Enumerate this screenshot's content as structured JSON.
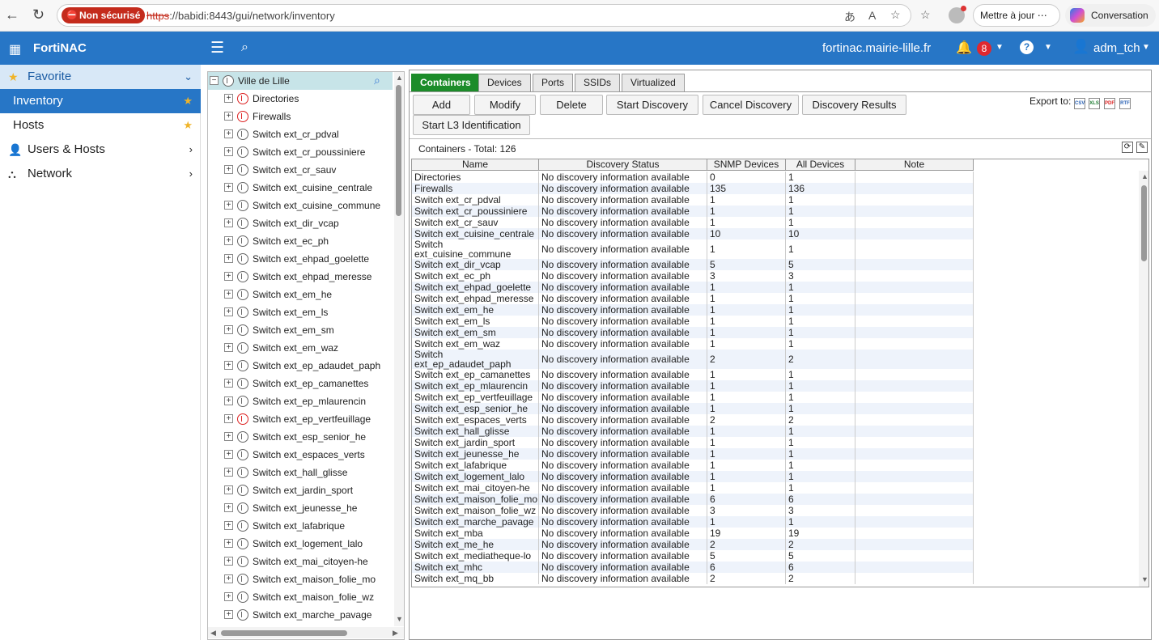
{
  "browser": {
    "insecure_label": "Non sécurisé",
    "url_proto": "https",
    "url_rest": "://babidi:8443/gui/network/inventory",
    "update_label": "Mettre à jour",
    "conversation_label": "Conversation"
  },
  "app": {
    "title": "FortiNAC",
    "hostname": "fortinac.mairie-lille.fr",
    "notification_count": "8",
    "username": "adm_tch"
  },
  "sidebar": {
    "favorite": "Favorite",
    "inventory": "Inventory",
    "hosts": "Hosts",
    "users_hosts": "Users & Hosts",
    "network": "Network"
  },
  "tree": {
    "root": "Ville de Lille",
    "items": [
      {
        "label": "Directories",
        "status": "red"
      },
      {
        "label": "Firewalls",
        "status": "red"
      },
      {
        "label": "Switch ext_cr_pdval",
        "status": "ok"
      },
      {
        "label": "Switch ext_cr_poussiniere",
        "status": "ok"
      },
      {
        "label": "Switch ext_cr_sauv",
        "status": "ok"
      },
      {
        "label": "Switch ext_cuisine_centrale",
        "status": "ok"
      },
      {
        "label": "Switch ext_cuisine_commune",
        "status": "ok"
      },
      {
        "label": "Switch ext_dir_vcap",
        "status": "ok"
      },
      {
        "label": "Switch ext_ec_ph",
        "status": "ok"
      },
      {
        "label": "Switch ext_ehpad_goelette",
        "status": "ok"
      },
      {
        "label": "Switch ext_ehpad_meresse",
        "status": "ok"
      },
      {
        "label": "Switch ext_em_he",
        "status": "ok"
      },
      {
        "label": "Switch ext_em_ls",
        "status": "ok"
      },
      {
        "label": "Switch ext_em_sm",
        "status": "ok"
      },
      {
        "label": "Switch ext_em_waz",
        "status": "ok"
      },
      {
        "label": "Switch ext_ep_adaudet_paph",
        "status": "ok"
      },
      {
        "label": "Switch ext_ep_camanettes",
        "status": "ok"
      },
      {
        "label": "Switch ext_ep_mlaurencin",
        "status": "ok"
      },
      {
        "label": "Switch ext_ep_vertfeuillage",
        "status": "red"
      },
      {
        "label": "Switch ext_esp_senior_he",
        "status": "ok"
      },
      {
        "label": "Switch ext_espaces_verts",
        "status": "ok"
      },
      {
        "label": "Switch ext_hall_glisse",
        "status": "ok"
      },
      {
        "label": "Switch ext_jardin_sport",
        "status": "ok"
      },
      {
        "label": "Switch ext_jeunesse_he",
        "status": "ok"
      },
      {
        "label": "Switch ext_lafabrique",
        "status": "ok"
      },
      {
        "label": "Switch ext_logement_lalo",
        "status": "ok"
      },
      {
        "label": "Switch ext_mai_citoyen-he",
        "status": "ok"
      },
      {
        "label": "Switch ext_maison_folie_mo",
        "status": "ok"
      },
      {
        "label": "Switch ext_maison_folie_wz",
        "status": "ok"
      },
      {
        "label": "Switch ext_marche_pavage",
        "status": "ok"
      }
    ]
  },
  "tabs": [
    "Containers",
    "Devices",
    "Ports",
    "SSIDs",
    "Virtualized Devices"
  ],
  "buttons": {
    "add": "Add",
    "modify": "Modify",
    "delete": "Delete",
    "start_discovery": "Start Discovery",
    "cancel_discovery": "Cancel Discovery",
    "discovery_results": "Discovery Results",
    "start_l3": "Start L3 Identification"
  },
  "export_label": "Export to:",
  "export_formats": [
    "CSV",
    "XLS",
    "PDF",
    "RTF"
  ],
  "total_label": "Containers - Total: 126",
  "table": {
    "columns": [
      "Name",
      "Discovery Status",
      "SNMP Devices",
      "All Devices",
      "Note"
    ],
    "rows": [
      [
        "Directories",
        "No discovery information available",
        "0",
        "1",
        ""
      ],
      [
        "Firewalls",
        "No discovery information available",
        "135",
        "136",
        ""
      ],
      [
        "Switch ext_cr_pdval",
        "No discovery information available",
        "1",
        "1",
        ""
      ],
      [
        "Switch ext_cr_poussiniere",
        "No discovery information available",
        "1",
        "1",
        ""
      ],
      [
        "Switch ext_cr_sauv",
        "No discovery information available",
        "1",
        "1",
        ""
      ],
      [
        "Switch ext_cuisine_centrale",
        "No discovery information available",
        "10",
        "10",
        ""
      ],
      [
        "Switch ext_cuisine_commune",
        "No discovery information available",
        "1",
        "1",
        ""
      ],
      [
        "Switch ext_dir_vcap",
        "No discovery information available",
        "5",
        "5",
        ""
      ],
      [
        "Switch ext_ec_ph",
        "No discovery information available",
        "3",
        "3",
        ""
      ],
      [
        "Switch ext_ehpad_goelette",
        "No discovery information available",
        "1",
        "1",
        ""
      ],
      [
        "Switch ext_ehpad_meresse",
        "No discovery information available",
        "1",
        "1",
        ""
      ],
      [
        "Switch ext_em_he",
        "No discovery information available",
        "1",
        "1",
        ""
      ],
      [
        "Switch ext_em_ls",
        "No discovery information available",
        "1",
        "1",
        ""
      ],
      [
        "Switch ext_em_sm",
        "No discovery information available",
        "1",
        "1",
        ""
      ],
      [
        "Switch ext_em_waz",
        "No discovery information available",
        "1",
        "1",
        ""
      ],
      [
        "Switch ext_ep_adaudet_paph",
        "No discovery information available",
        "2",
        "2",
        ""
      ],
      [
        "Switch ext_ep_camanettes",
        "No discovery information available",
        "1",
        "1",
        ""
      ],
      [
        "Switch ext_ep_mlaurencin",
        "No discovery information available",
        "1",
        "1",
        ""
      ],
      [
        "Switch ext_ep_vertfeuillage",
        "No discovery information available",
        "1",
        "1",
        ""
      ],
      [
        "Switch ext_esp_senior_he",
        "No discovery information available",
        "1",
        "1",
        ""
      ],
      [
        "Switch ext_espaces_verts",
        "No discovery information available",
        "2",
        "2",
        ""
      ],
      [
        "Switch ext_hall_glisse",
        "No discovery information available",
        "1",
        "1",
        ""
      ],
      [
        "Switch ext_jardin_sport",
        "No discovery information available",
        "1",
        "1",
        ""
      ],
      [
        "Switch ext_jeunesse_he",
        "No discovery information available",
        "1",
        "1",
        ""
      ],
      [
        "Switch ext_lafabrique",
        "No discovery information available",
        "1",
        "1",
        ""
      ],
      [
        "Switch ext_logement_lalo",
        "No discovery information available",
        "1",
        "1",
        ""
      ],
      [
        "Switch ext_mai_citoyen-he",
        "No discovery information available",
        "1",
        "1",
        ""
      ],
      [
        "Switch ext_maison_folie_mo",
        "No discovery information available",
        "6",
        "6",
        ""
      ],
      [
        "Switch ext_maison_folie_wz",
        "No discovery information available",
        "3",
        "3",
        ""
      ],
      [
        "Switch ext_marche_pavage",
        "No discovery information available",
        "1",
        "1",
        ""
      ],
      [
        "Switch ext_mba",
        "No discovery information available",
        "19",
        "19",
        ""
      ],
      [
        "Switch ext_me_he",
        "No discovery information available",
        "2",
        "2",
        ""
      ],
      [
        "Switch ext_mediatheque-lo",
        "No discovery information available",
        "5",
        "5",
        ""
      ],
      [
        "Switch ext_mhc",
        "No discovery information available",
        "6",
        "6",
        ""
      ],
      [
        "Switch ext_mq_bb",
        "No discovery information available",
        "2",
        "2",
        ""
      ]
    ]
  }
}
